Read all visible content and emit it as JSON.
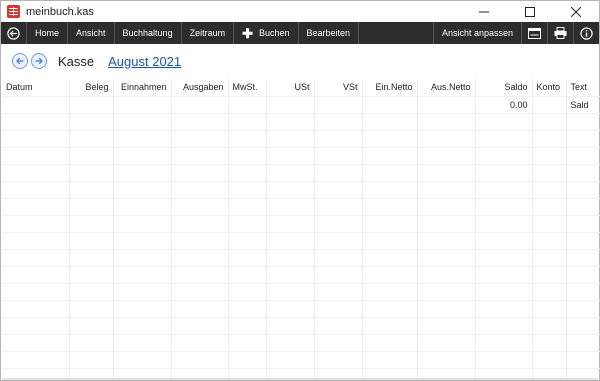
{
  "window": {
    "title": "meinbuch.kas"
  },
  "toolbar": {
    "menu": [
      {
        "label": "Home",
        "name": "menu-home"
      },
      {
        "label": "Ansicht",
        "name": "menu-ansicht"
      },
      {
        "label": "Buchhaltung",
        "name": "menu-buchhaltung"
      },
      {
        "label": "Zeitraum",
        "name": "menu-zeitraum"
      },
      {
        "label": "Buchen",
        "name": "menu-buchen"
      },
      {
        "label": "Bearbeiten",
        "name": "menu-bearbeiten"
      }
    ],
    "adjust_view_label": "Ansicht anpassen"
  },
  "nav": {
    "title": "Kasse",
    "period": "August 2021"
  },
  "table": {
    "columns": [
      "Datum",
      "Beleg",
      "Einnahmen",
      "Ausgaben",
      "MwSt.",
      "USt",
      "VSt",
      "Ein.Netto",
      "Aus.Netto",
      "Saldo",
      "Konto",
      "Text"
    ],
    "first_row": {
      "saldo": "0.00",
      "text": "Sald"
    }
  }
}
